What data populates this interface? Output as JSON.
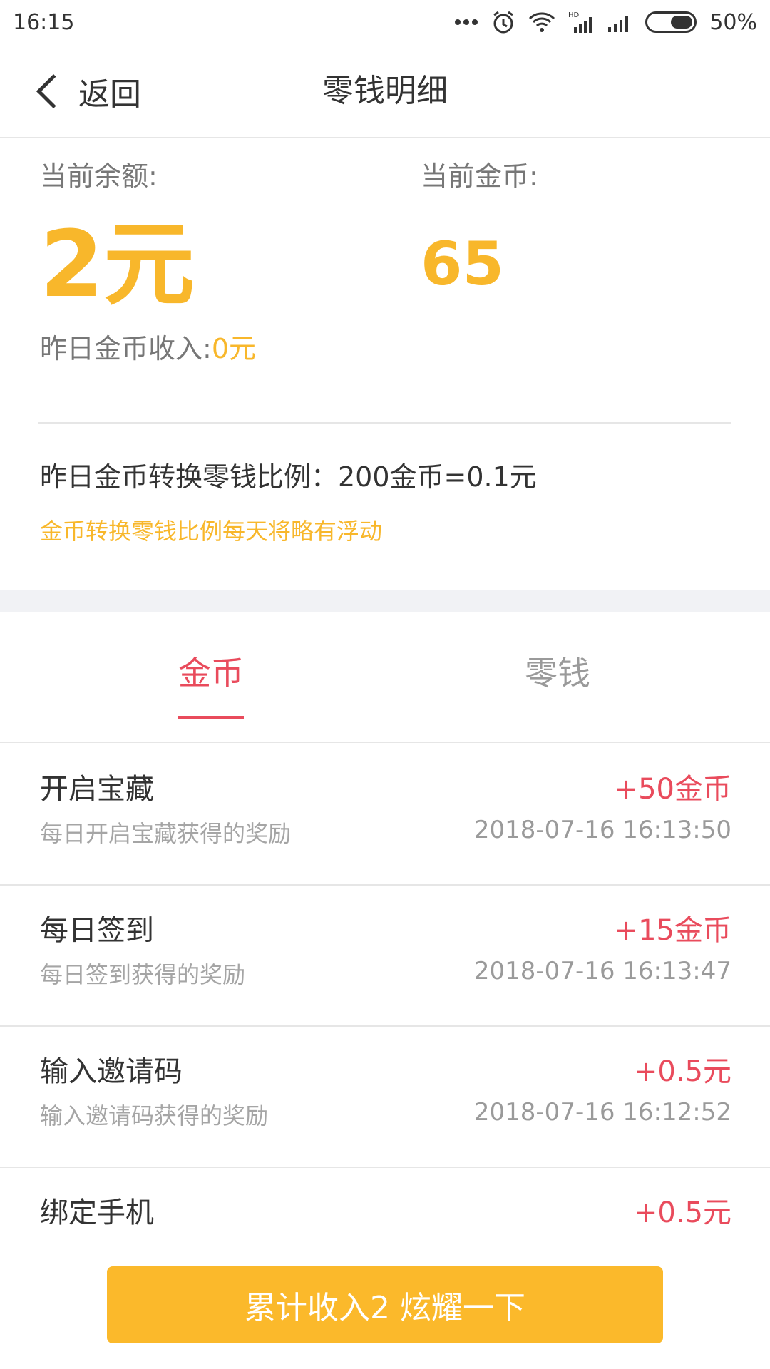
{
  "status_bar": {
    "time": "16:15",
    "battery": "50%",
    "icons": [
      "more-dots-icon",
      "alarm-icon",
      "wifi-icon",
      "hd-signal-icon",
      "signal-icon",
      "battery-icon"
    ]
  },
  "header": {
    "back_label": "返回",
    "title": "零钱明细"
  },
  "summary": {
    "balance_label": "当前余额:",
    "balance_value": "2元",
    "coins_label": "当前金币:",
    "coins_value": "65",
    "yesterday_label": "昨日金币收入:",
    "yesterday_value": "0元",
    "ratio_text": "昨日金币转换零钱比例：200金币=0.1元",
    "note": "金币转换零钱比例每天将略有浮动"
  },
  "tabs": [
    {
      "label": "金币",
      "active": true
    },
    {
      "label": "零钱",
      "active": false
    }
  ],
  "records": [
    {
      "title": "开启宝藏",
      "subtitle": "每日开启宝藏获得的奖励",
      "amount": "+50金币",
      "time": "2018-07-16 16:13:50"
    },
    {
      "title": "每日签到",
      "subtitle": "每日签到获得的奖励",
      "amount": "+15金币",
      "time": "2018-07-16 16:13:47"
    },
    {
      "title": "输入邀请码",
      "subtitle": "输入邀请码获得的奖励",
      "amount": "+0.5元",
      "time": "2018-07-16 16:12:52"
    },
    {
      "title": "绑定手机",
      "subtitle": "",
      "amount": "+0.5元",
      "time": ""
    }
  ],
  "cta": {
    "label": "累计收入2 炫耀一下"
  },
  "colors": {
    "accent_yellow": "#f8b72b",
    "accent_red": "#e94b5c",
    "divider": "#e6e6e6",
    "band_gray": "#f1f2f5"
  }
}
